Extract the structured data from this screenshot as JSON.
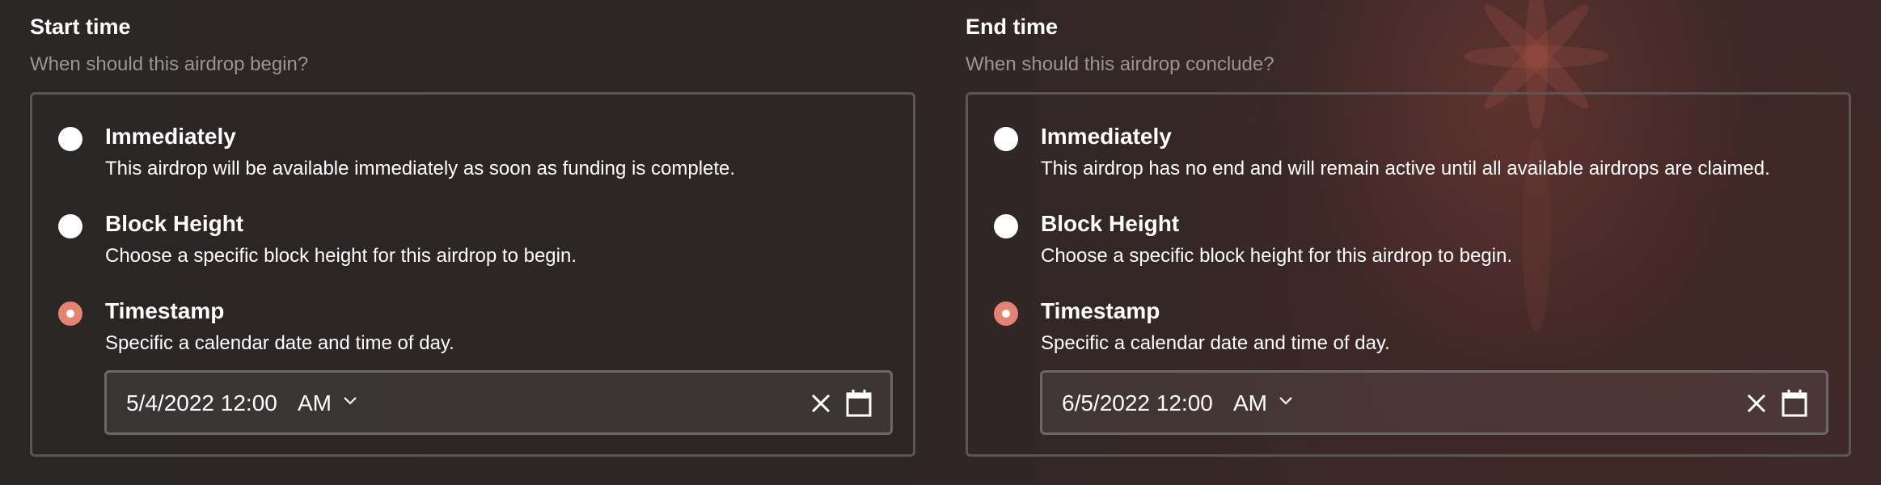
{
  "start": {
    "title": "Start time",
    "subtitle": "When should this airdrop begin?",
    "options": [
      {
        "label": "Immediately",
        "desc": "This airdrop will be available immediately as soon as funding is complete.",
        "checked": false
      },
      {
        "label": "Block Height",
        "desc": "Choose a specific block height for this airdrop to begin.",
        "checked": false
      },
      {
        "label": "Timestamp",
        "desc": "Specific a calendar date and time of day.",
        "checked": true
      }
    ],
    "datetime": {
      "value": "5/4/2022 12:00",
      "ampm": "AM"
    }
  },
  "end": {
    "title": "End time",
    "subtitle": "When should this airdrop conclude?",
    "options": [
      {
        "label": "Immediately",
        "desc": "This airdrop has no end and will remain active until all available airdrops are claimed.",
        "checked": false
      },
      {
        "label": "Block Height",
        "desc": "Choose a specific block height for this airdrop to begin.",
        "checked": false
      },
      {
        "label": "Timestamp",
        "desc": "Specific a calendar date and time of day.",
        "checked": true
      }
    ],
    "datetime": {
      "value": "6/5/2022 12:00",
      "ampm": "AM"
    }
  },
  "icons": {
    "dropdown": "chevron-down-icon",
    "clear": "close-icon",
    "calendar": "calendar-icon"
  },
  "colors": {
    "accent": "#e58373",
    "subtitle": "#9b9593",
    "border": "#5b5655"
  }
}
